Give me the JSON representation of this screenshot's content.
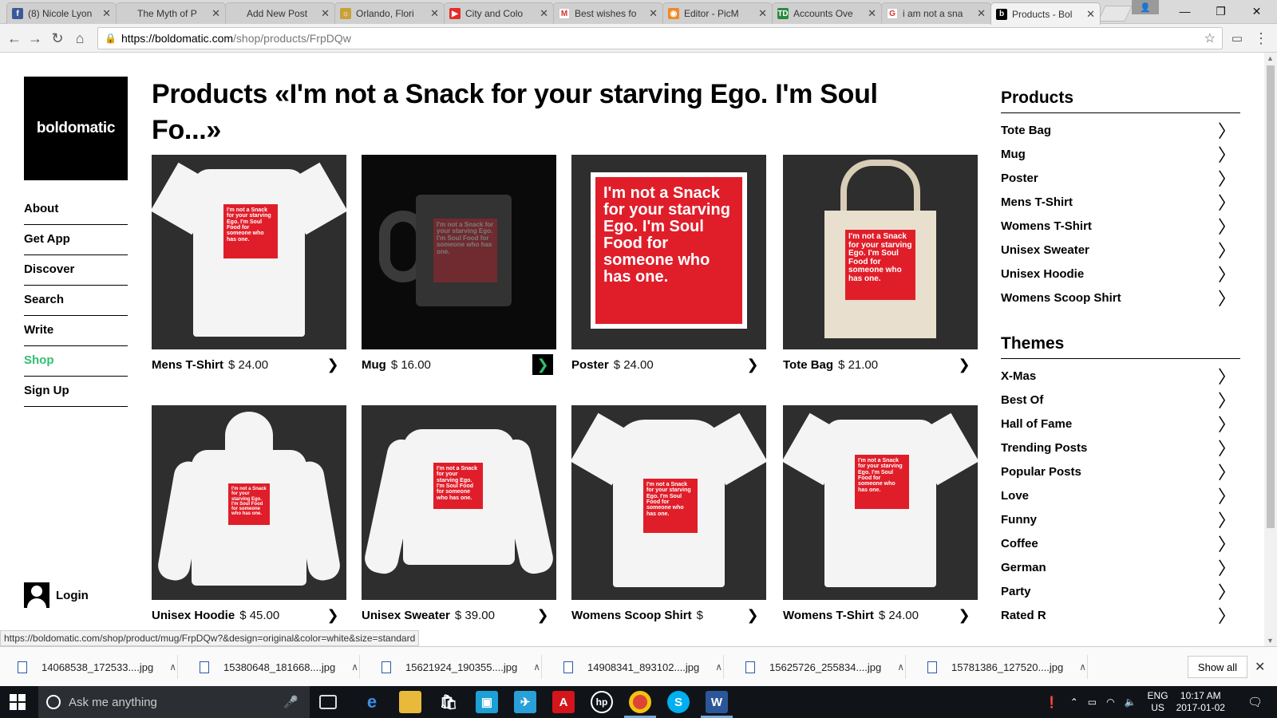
{
  "browser": {
    "tabs": [
      {
        "title": "(8) Nicole Lyon",
        "favicon": "facebook",
        "color": "#3b5998",
        "glyph": "f"
      },
      {
        "title": "The Myth of P",
        "favicon": "blank",
        "color": "#cfcfcf",
        "glyph": ""
      },
      {
        "title": "Add New Post",
        "favicon": "blank",
        "color": "#cfcfcf",
        "glyph": ""
      },
      {
        "title": "Orlando, Flori",
        "favicon": "weather",
        "color": "#c9a13b",
        "glyph": "☼"
      },
      {
        "title": "City and Colo",
        "favicon": "youtube",
        "color": "#e52d27",
        "glyph": "▶"
      },
      {
        "title": "Best wishes fo",
        "favicon": "gmail",
        "color": "#ffffff",
        "glyph": "M"
      },
      {
        "title": "Editor - PicM",
        "favicon": "picmonkey",
        "color": "#f08a24",
        "glyph": "◉"
      },
      {
        "title": "Accounts Ove",
        "favicon": "td-bank",
        "color": "#2b8a3e",
        "glyph": "TD"
      },
      {
        "title": "i am not a sna",
        "favicon": "google",
        "color": "#ffffff",
        "glyph": "G"
      },
      {
        "title": "Products - Bol",
        "favicon": "boldomatic",
        "color": "#000000",
        "glyph": "b"
      }
    ],
    "url_host": "https://boldomatic.com",
    "url_path": "/shop/products/FrpDQw",
    "status_url": "https://boldomatic.com/shop/product/mug/FrpDQw?&design=original&color=white&size=standard"
  },
  "site": {
    "logo": "boldomatic",
    "nav": [
      {
        "label": "About",
        "active": false
      },
      {
        "label": "Get App",
        "active": false
      },
      {
        "label": "Discover",
        "active": false
      },
      {
        "label": "Search",
        "active": false
      },
      {
        "label": "Write",
        "active": false
      },
      {
        "label": "Shop",
        "active": true
      },
      {
        "label": "Sign Up",
        "active": false
      }
    ],
    "login": "Login",
    "title": "Products «I'm not a Snack for your starving Ego. I'm Soul Fo...»",
    "quote": "I'm not a Snack for your starving Ego. I'm Soul Food for someone who has one.",
    "accent_color": "#2fbf71",
    "quote_box_color": "#e01e2a"
  },
  "products": [
    {
      "name": "Mens T-Shirt",
      "price": "$ 24.00",
      "kind": "tshirt"
    },
    {
      "name": "Mug",
      "price": "$ 16.00",
      "kind": "mug"
    },
    {
      "name": "Poster",
      "price": "$ 24.00",
      "kind": "poster"
    },
    {
      "name": "Tote Bag",
      "price": "$ 21.00",
      "kind": "tote"
    },
    {
      "name": "Unisex Hoodie",
      "price": "$ 45.00",
      "kind": "hoodie"
    },
    {
      "name": "Unisex Sweater",
      "price": "$ 39.00",
      "kind": "sweater"
    },
    {
      "name": "Womens Scoop Shirt",
      "price": "$",
      "kind": "scoop"
    },
    {
      "name": "Womens T-Shirt",
      "price": "$ 24.00",
      "kind": "tshirt"
    }
  ],
  "sidebar": {
    "products_heading": "Products",
    "products": [
      "Tote Bag",
      "Mug",
      "Poster",
      "Mens T-Shirt",
      "Womens T-Shirt",
      "Unisex Sweater",
      "Unisex Hoodie",
      "Womens Scoop Shirt"
    ],
    "themes_heading": "Themes",
    "themes": [
      "X-Mas",
      "Best Of",
      "Hall of Fame",
      "Trending Posts",
      "Popular Posts",
      "Love",
      "Funny",
      "Coffee",
      "German",
      "Party",
      "Rated R"
    ]
  },
  "downloads": {
    "files": [
      "14068538_172533....jpg",
      "15380648_181668....jpg",
      "15621924_190355....jpg",
      "14908341_893102....jpg",
      "15625726_255834....jpg",
      "15781386_127520....jpg"
    ],
    "show_all": "Show all"
  },
  "taskbar": {
    "search_placeholder": "Ask me anything",
    "language": "ENG",
    "region": "US",
    "time": "10:17 AM",
    "date": "2017-01-02"
  }
}
